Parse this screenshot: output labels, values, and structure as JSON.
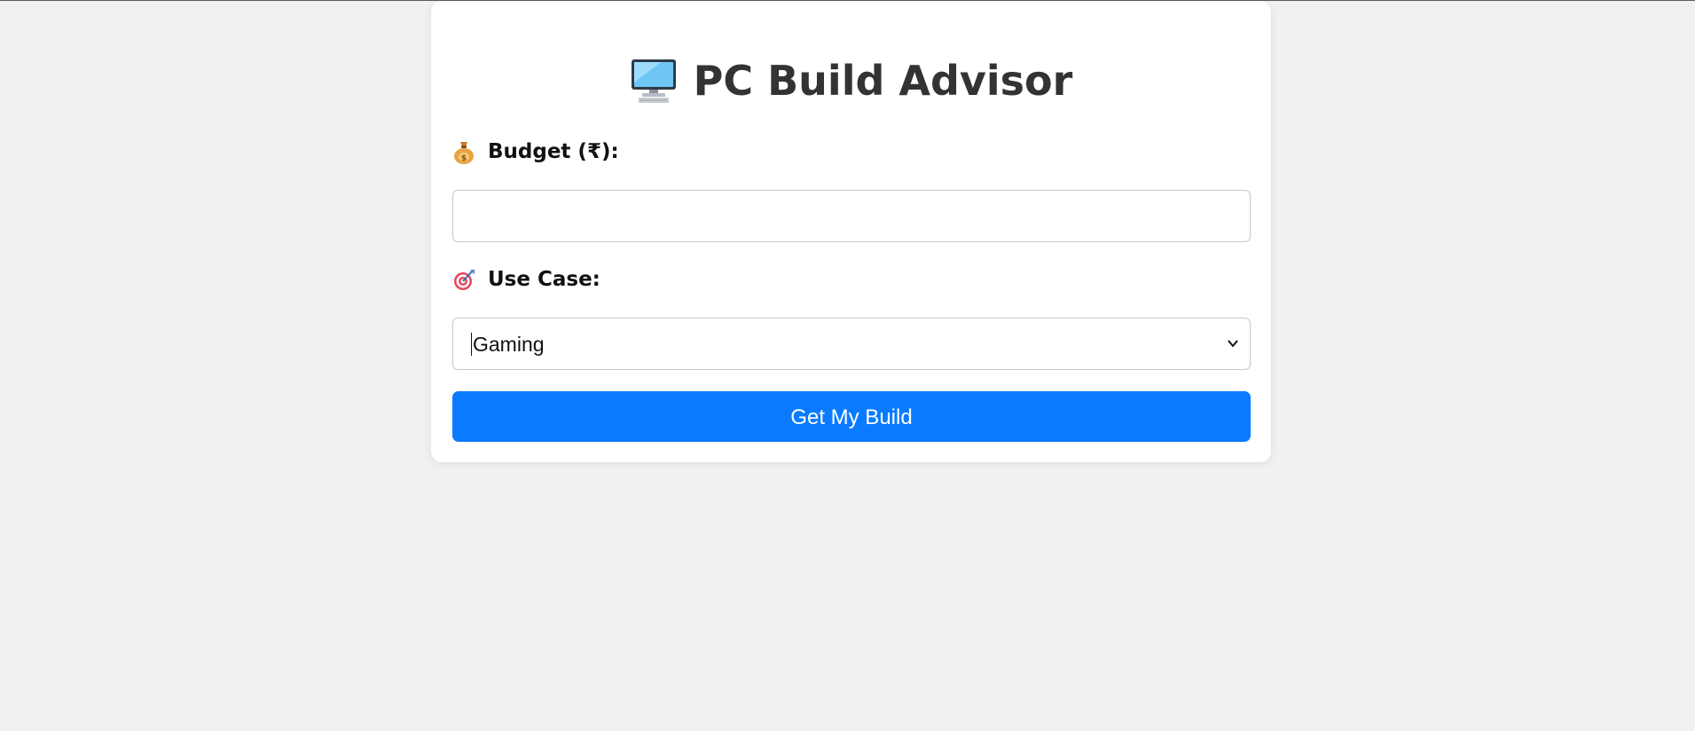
{
  "app": {
    "title": "PC Build Advisor"
  },
  "form": {
    "budget_label": "Budget (₹):",
    "budget_value": "",
    "budget_icon": "money-bag-icon",
    "use_case_label": "Use Case:",
    "use_case_icon": "target-icon",
    "use_case_selected": "Gaming",
    "submit_label": "Get My Build"
  },
  "colors": {
    "page_background": "#f1f1f1",
    "card_background": "#ffffff",
    "title_text": "#333333",
    "button_background": "#0a7bff",
    "button_text": "#ffffff",
    "input_border": "#c8c8c8"
  },
  "icons": {
    "title_icon": "desktop-computer-icon"
  }
}
